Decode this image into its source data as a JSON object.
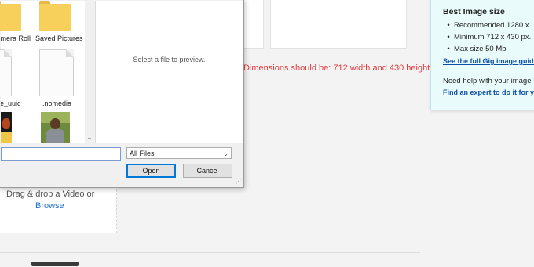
{
  "page": {
    "dimension_error": "Dimensions should be: 712 width and 430 height",
    "drag_drop_text": "Drag & drop a Video or",
    "browse_label": "Browse"
  },
  "info_panel": {
    "title": "Best Image size",
    "items": [
      "Recommended 1280 x",
      "Minimum 712 x 430 px.",
      "Max size 50 Mb"
    ],
    "guide_link": "See the full Gig image guide",
    "help_text": "Need help with your image",
    "expert_link": "Find an expert to do it for y"
  },
  "dialog": {
    "files": [
      {
        "label": "Camera Roll",
        "icon": "folder-icon"
      },
      {
        "label": "Saved Pictures",
        "icon": "folder-icon"
      },
      {
        "label": "device_uuid",
        "icon": "document-icon"
      },
      {
        "label": ".nomedia",
        "icon": "document-icon"
      },
      {
        "label": "",
        "icon": "photo-thumbnail"
      },
      {
        "label": "",
        "icon": "photo-thumbnail"
      }
    ],
    "preview_text": "Select a file to preview.",
    "filename_value": "",
    "filetype_value": "All Files",
    "open_label": "Open",
    "cancel_label": "Cancel"
  },
  "colors": {
    "error": "#e5383b",
    "link": "#0a4fa8",
    "panel_bg": "#e9fbfb",
    "folder": "#f7cf5b",
    "open_border": "#0078d7"
  }
}
